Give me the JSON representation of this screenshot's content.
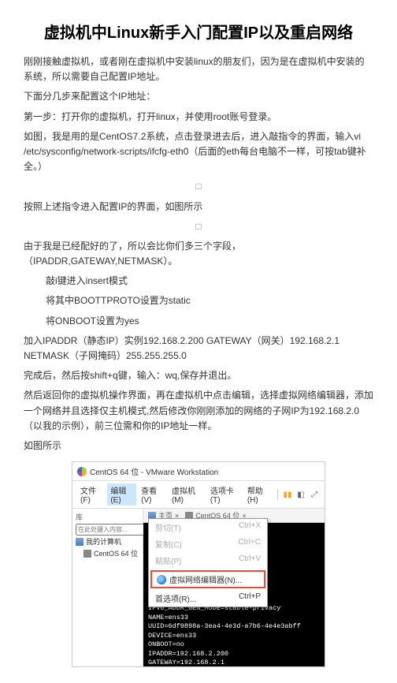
{
  "title": "虚拟机中Linux新手入门配置IP以及重启网络",
  "p1": "刚刚接触虚拟机，或者刚在虚拟机中安装linux的朋友们，因为是在虚拟机中安装的系统，所以需要自己配置IP地址。",
  "p2": "下面分几步来配置这个IP地址：",
  "p3": "第一步：打开你的虚拟机，打开linux，并使用root账号登录。",
  "p4": "如图，我是用的是CentOS7.2系统，点击登录进去后，进入敲指令的界面，输入vi /etc/sysconfig/network-scripts/ifcfg-eth0（后面的eth每台电脑不一样，可按tab键补全。）",
  "p5": "按照上述指令进入配置IP的界面，如图所示",
  "p6": "由于我是已经配好的了，所以会比你们多三个字段，（IPADDR,GATEWAY,NETMASK）。",
  "li1": "敲i键进入insert模式",
  "li2": "将其中BOOTTPROTO设置为static",
  "li3": "将ONBOOT设置为yes",
  "p7": "加入IPADDR（静态IP）实例192.168.2.200 GATEWAY（网关）192.168.2.1 NETMASK（子网掩码）255.255.255.0",
  "p8": "完成后，然后按shift+q键，输入：wq,保存并退出。",
  "p9": "然后返回你的虚拟机操作界面，再在虚拟机中点击编辑，选择虚拟网络编辑器，添加一个网络并且选择仅主机模式,然后修改你刚刚添加的网络的子网IP为192.168.2.0（以我的示例），前三位需和你的IP地址一样。",
  "p10": "如图所示",
  "vmware": {
    "title": "CentOS 64 位 - VMware Workstation",
    "menu": {
      "file": "文件(F)",
      "edit": "编辑(E)",
      "view": "查看(V)",
      "vm": "虚拟机(M)",
      "tabs": "选项卡(T)",
      "help": "帮助(H)"
    },
    "sidebar_label": "库",
    "search_placeholder": "在此处键入内容...",
    "tree_home": "我的计算机",
    "tree_vm": "CentOS 64 位",
    "tab_home": "主页",
    "tab_vm": "CentOS 64 位",
    "ctx": {
      "cut": "剪切(T)",
      "cut_k": "Ctrl+X",
      "copy": "复制(C)",
      "copy_k": "Ctrl+C",
      "paste": "粘贴(P)",
      "paste_k": "Ctrl+V",
      "vne": "虚拟网络编辑器(N)...",
      "pref": "首选项(R)...",
      "pref_k": "Ctrl+P"
    },
    "terminal": "IPV6_FAILURE_FATAL=no\nIPV6INIT=yes\nIPV6_AUTOCONF=yes\nIPV6_DEFROUTE=yes\nIPV6_FAILURE_FATAL=no\nIPV6_ADDR_GEN_MODE=stable-privacy\nNAME=ens33\nUUID=6df9898a-3ea4-4e3d-a7b6-4e4e3abff\nDEVICE=ens33\nONBOOT=no\nIPADDR=192.168.2.200\nGATEWAY=192.168.2.1"
  }
}
